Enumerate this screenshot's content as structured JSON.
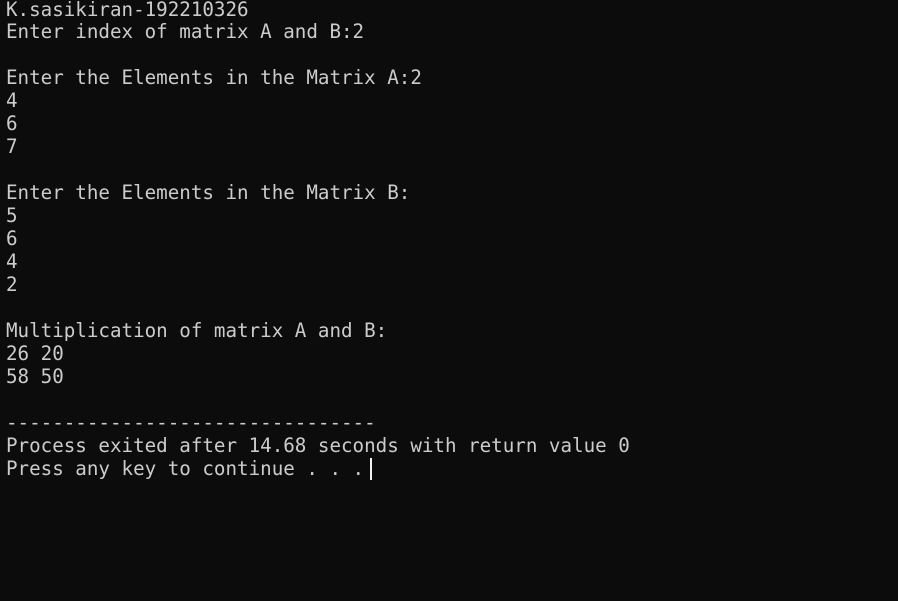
{
  "console": {
    "lines": [
      "K.sasikiran-192210326",
      "Enter index of matrix A and B:2",
      "",
      "Enter the Elements in the Matrix A:2",
      "4",
      "6",
      "7",
      "",
      "Enter the Elements in the Matrix B:",
      "5",
      "6",
      "4",
      "2",
      "",
      "Multiplication of matrix A and B:",
      "26 20",
      "58 50",
      "",
      "--------------------------------",
      "Process exited after 14.68 seconds with return value 0",
      "Press any key to continue . . ."
    ]
  },
  "colors": {
    "background": "#0c0c0c",
    "text": "#cccccc",
    "cursor": "#f2f2f2"
  }
}
